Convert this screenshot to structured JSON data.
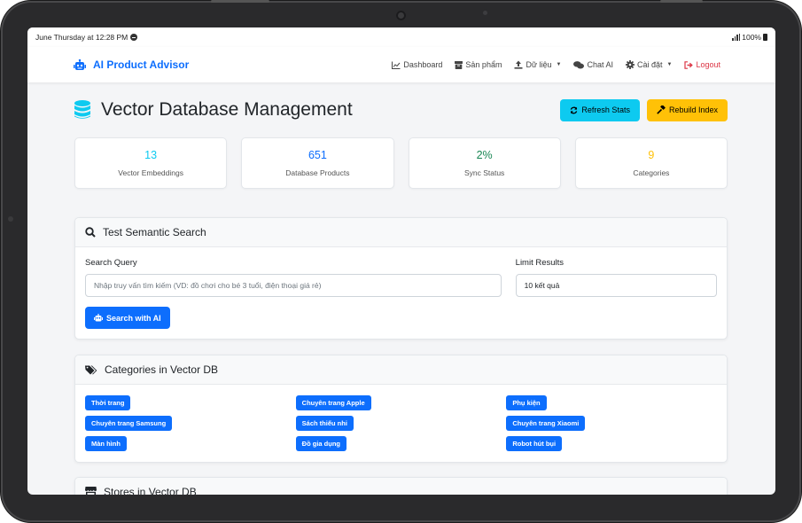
{
  "statusbar": {
    "time_text": "June Thursday at 12:28 PM",
    "battery_text": "100%"
  },
  "navbar": {
    "brand": "AI Product Advisor",
    "links": [
      {
        "label": "Dashboard",
        "icon": "chart-line-icon"
      },
      {
        "label": "Sản phẩm",
        "icon": "box-icon"
      },
      {
        "label": "Dữ liệu",
        "icon": "upload-icon"
      },
      {
        "label": "Chat AI",
        "icon": "comments-icon"
      },
      {
        "label": "Cài đặt",
        "icon": "cog-icon"
      },
      {
        "label": "Logout",
        "icon": "sign-out-icon"
      }
    ]
  },
  "header": {
    "title": "Vector Database Management",
    "refresh_label": "Refresh Stats",
    "rebuild_label": "Rebuild Index"
  },
  "stats": [
    {
      "value": "13",
      "label": "Vector Embeddings",
      "color": "#0dcaf0"
    },
    {
      "value": "651",
      "label": "Database Products",
      "color": "#0d6efd"
    },
    {
      "value": "2%",
      "label": "Sync Status",
      "color": "#198754"
    },
    {
      "value": "9",
      "label": "Categories",
      "color": "#ffc107"
    }
  ],
  "search": {
    "panel_title": "Test Semantic Search",
    "query_label": "Search Query",
    "query_placeholder": "Nhập truy vấn tìm kiếm (VD: đồ chơi cho bé 3 tuổi, điện thoại giá rẻ)",
    "limit_label": "Limit Results",
    "limit_value": "10 kết quả",
    "button_label": "Search with AI"
  },
  "categories": {
    "panel_title": "Categories in Vector DB",
    "items": [
      "Thời trang",
      "Chuyên trang Apple",
      "Phụ kiện",
      "Chuyên trang Samsung",
      "Sách thiếu nhi",
      "Chuyên trang Xiaomi",
      "Màn hình",
      "Đồ gia dụng",
      "Robot hút bụi"
    ]
  },
  "stores": {
    "panel_title": "Stores in Vector DB"
  },
  "colors": {
    "primary": "#0d6efd",
    "info": "#0dcaf0",
    "warning": "#ffc107",
    "danger": "#dc3545",
    "success": "#198754"
  }
}
